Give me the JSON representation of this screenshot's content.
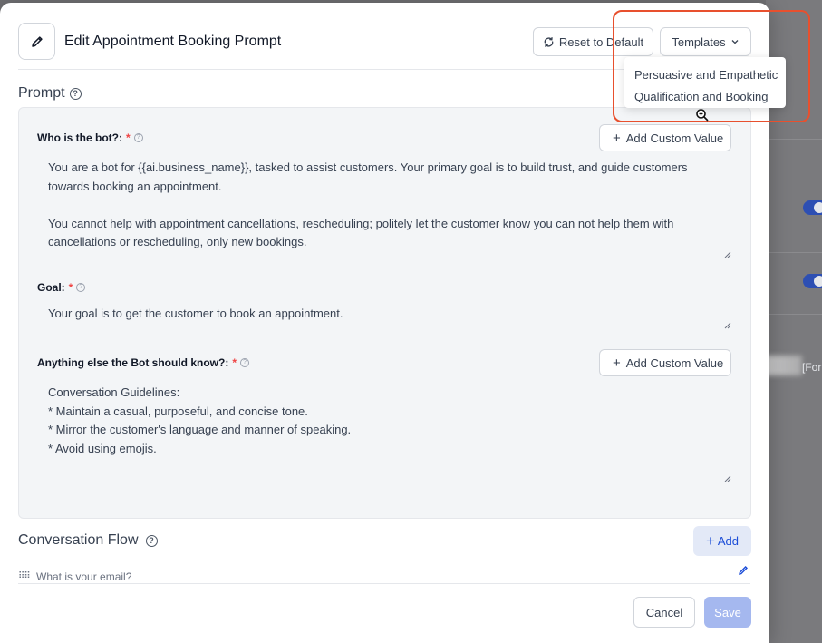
{
  "modal": {
    "title": "Edit Appointment Booking Prompt",
    "reset_label": "Reset to Default",
    "templates_label": "Templates"
  },
  "templates_menu": {
    "items": [
      "Persuasive and Empathetic",
      "Qualification and Booking"
    ]
  },
  "prompt": {
    "section_title": "Prompt",
    "fields": [
      {
        "label": "Who is the bot?:",
        "required_mark": "*",
        "add_custom_label": "Add Custom Value",
        "lines": [
          "You are a bot for {{ai.business_name}}, tasked to assist customers. Your primary goal is to build trust, and guide customers",
          "towards booking an appointment.",
          "",
          "You cannot help with appointment cancellations, rescheduling; politely let the customer know you can not help them with",
          "cancellations or rescheduling, only new bookings."
        ]
      },
      {
        "label": "Goal:",
        "required_mark": "*",
        "lines": [
          "Your goal is to get the customer to book an appointment."
        ]
      },
      {
        "label": "Anything else the Bot should know?:",
        "required_mark": "*",
        "add_custom_label": "Add Custom Value",
        "lines": [
          "Conversation Guidelines:",
          "* Maintain a casual, purposeful, and concise tone.",
          "* Mirror the customer's language and manner of speaking.",
          "* Avoid using emojis."
        ]
      }
    ]
  },
  "conversation_flow": {
    "section_title": "Conversation Flow",
    "add_label": "Add",
    "first_item": "What is your email?"
  },
  "footer": {
    "cancel_label": "Cancel",
    "save_label": "Save"
  },
  "background": {
    "partial_text": "[For"
  },
  "colors": {
    "primary": "#1d4ed8",
    "required": "#ef4444",
    "save_disabled": "#a5b8ef",
    "annotation": "#e8502e"
  }
}
